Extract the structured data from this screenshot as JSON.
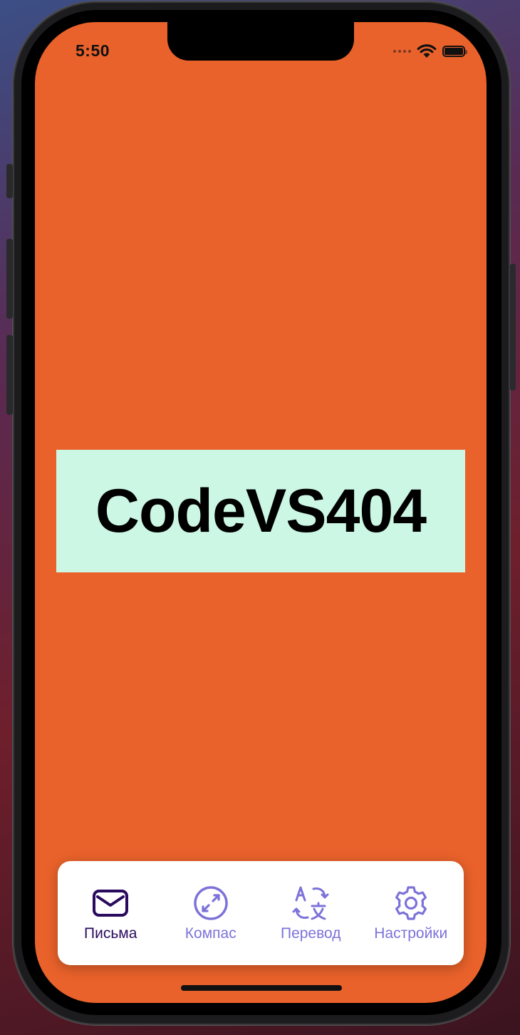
{
  "status_bar": {
    "time": "5:50"
  },
  "main": {
    "title": "CodeVS404"
  },
  "tab_bar": {
    "items": [
      {
        "label": "Письма",
        "icon": "envelope-icon",
        "active": true
      },
      {
        "label": "Компас",
        "icon": "compass-icon",
        "active": false
      },
      {
        "label": "Перевод",
        "icon": "translate-icon",
        "active": false
      },
      {
        "label": "Настройки",
        "icon": "gear-icon",
        "active": false
      }
    ]
  },
  "colors": {
    "screen_background": "#ea622b",
    "banner_background": "#ccf7e4",
    "tab_active": "#2a0a5e",
    "tab_inactive": "#7c72d9"
  }
}
